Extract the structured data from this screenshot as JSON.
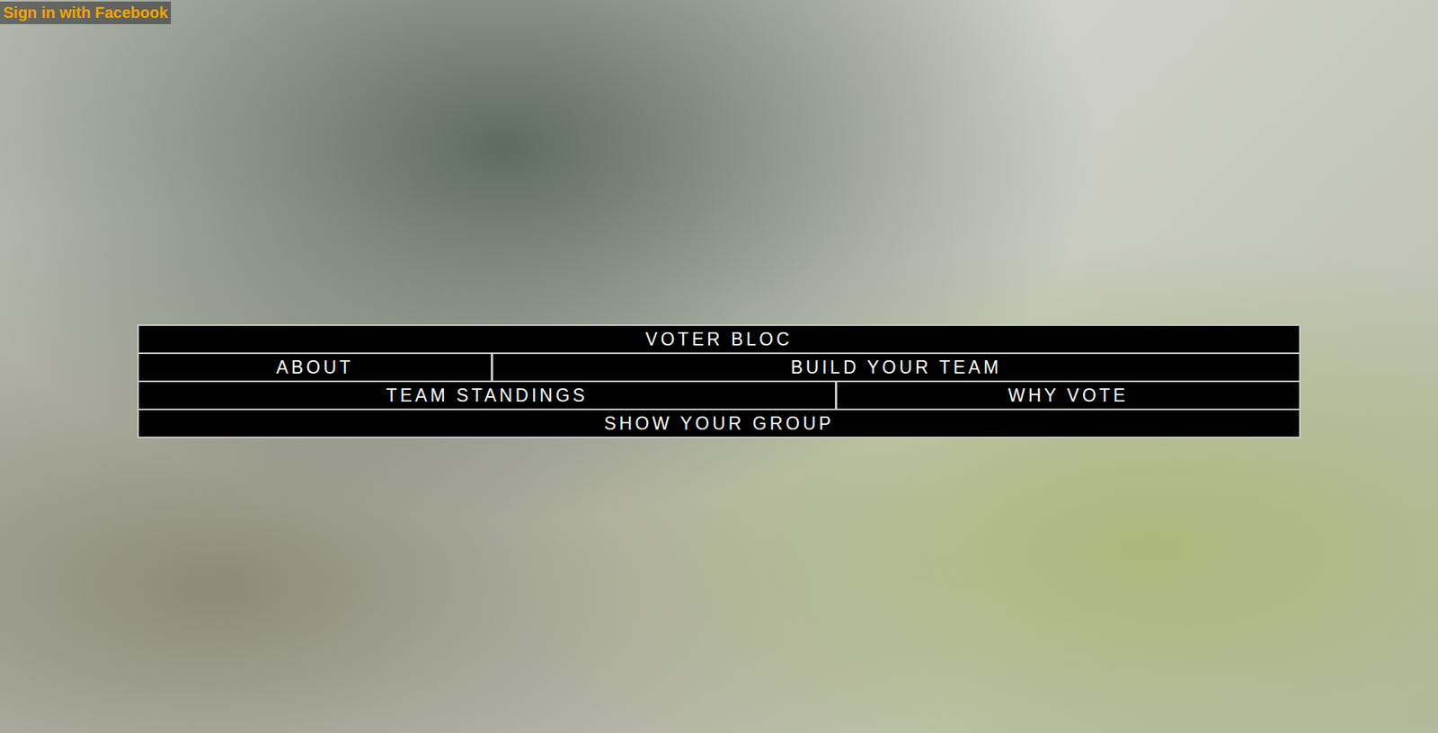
{
  "auth": {
    "sign_in": "Sign in with Facebook"
  },
  "nav": {
    "rows": [
      [
        {
          "label": "VOTER BLOC"
        }
      ],
      [
        {
          "label": "ABOUT"
        },
        {
          "label": "BUILD YOUR TEAM"
        }
      ],
      [
        {
          "label": "TEAM STANDINGS"
        },
        {
          "label": "WHY VOTE"
        }
      ],
      [
        {
          "label": "SHOW YOUR GROUP"
        }
      ]
    ]
  }
}
